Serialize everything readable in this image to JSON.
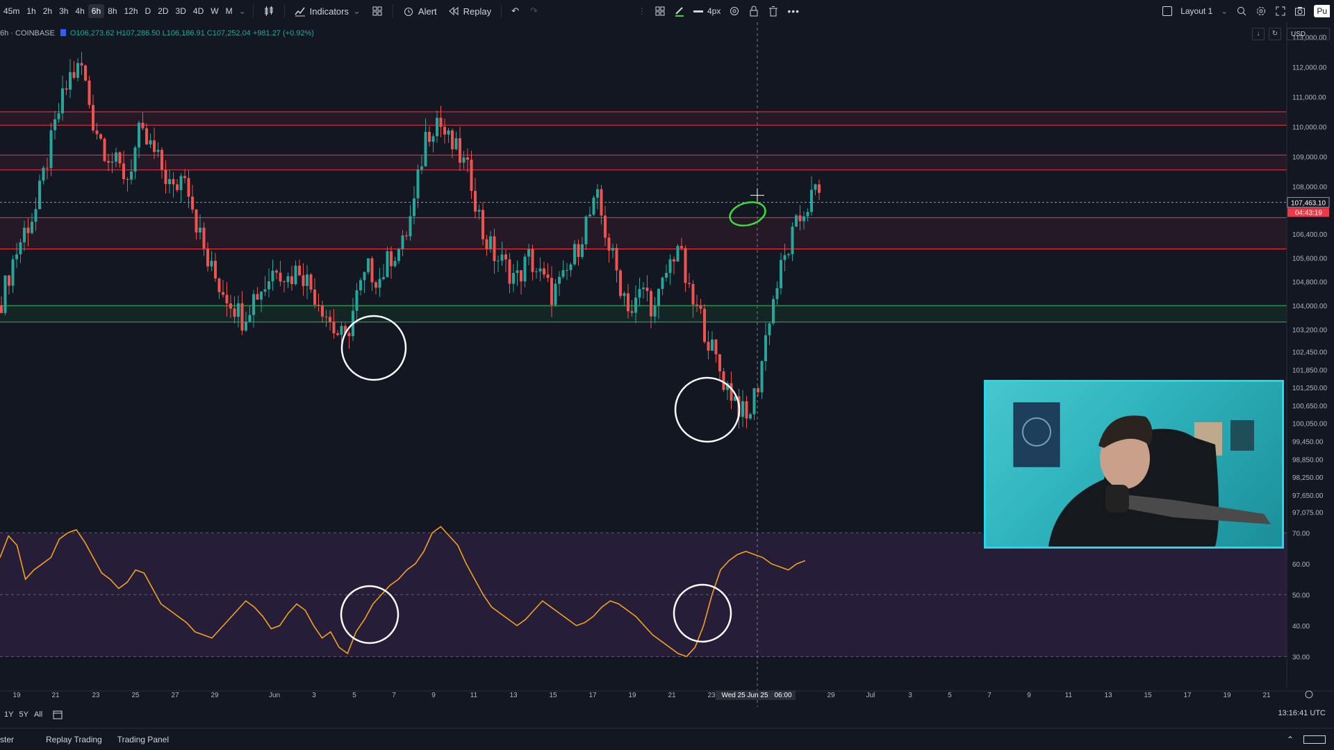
{
  "toolbar": {
    "timeframes": [
      "45m",
      "1h",
      "2h",
      "3h",
      "4h",
      "6h",
      "8h",
      "12h",
      "D",
      "2D",
      "3D",
      "4D",
      "W",
      "M"
    ],
    "active_timeframe": "6h",
    "indicators_label": "Indicators",
    "alert_label": "Alert",
    "replay_label": "Replay",
    "line_width_label": "4px",
    "layout_label": "Layout 1",
    "publish_label": "Pu"
  },
  "legend": {
    "symbol": "6h · COINBASE",
    "ohlc": "O106,273.62 H107,286.50 L106,186.91 C107,252.04 +981.27 (+0.92%)"
  },
  "currency": "USD",
  "chart_data": {
    "type": "candlestick",
    "timeframe": "6h",
    "symbol_exchange": "COINBASE",
    "price_ticks": [
      "113,000.00",
      "112,000.00",
      "111,000.00",
      "110,000.00",
      "109,000.00",
      "108,000.00",
      "107,463.10",
      "106,400.00",
      "105,600.00",
      "104,800.00",
      "104,000.00",
      "103,200.00",
      "102,450.00",
      "101,850.00",
      "101,250.00",
      "100,650.00",
      "100,050.00",
      "99,450.00",
      "98,850.00",
      "98,250.00",
      "97,650.00",
      "97,075.00"
    ],
    "price_ticks_plain": [
      113000,
      112000,
      111000,
      110000,
      109000,
      108000,
      106400,
      105600,
      104800,
      104000,
      103200,
      102450,
      101850,
      101250,
      100650,
      100050,
      99450,
      98850,
      98250,
      97650,
      97075
    ],
    "current_price_label": "107,463.10",
    "countdown_label": "04:43:19",
    "current_price": 107463.1,
    "ylim": [
      96900,
      113200
    ],
    "date_labels": [
      "19",
      "21",
      "23",
      "25",
      "27",
      "29",
      "Jun",
      "3",
      "5",
      "7",
      "9",
      "11",
      "13",
      "15",
      "17",
      "19",
      "21",
      "23",
      "Wed 25 Jun 25",
      "06:00",
      "29",
      "Jul",
      "3",
      "5",
      "7",
      "9",
      "11",
      "13",
      "15",
      "17",
      "19",
      "21"
    ],
    "crosshair_date": "Wed 25 Jun 25",
    "crosshair_time": "06:00",
    "resistance_zones": [
      [
        110050,
        110500
      ],
      [
        108550,
        109050
      ],
      [
        105900,
        106950
      ]
    ],
    "support_zone": [
      103450,
      104000
    ],
    "close_path": [
      104200,
      105500,
      106500,
      107200,
      108900,
      110500,
      111700,
      112000,
      110200,
      109300,
      108700,
      108300,
      109700,
      109300,
      108600,
      107800,
      108600,
      106800,
      105400,
      104700,
      104200,
      103600,
      104300,
      104700,
      105400,
      104900,
      105300,
      104600,
      104000,
      103200,
      102800,
      104300,
      105200,
      104900,
      105700,
      106000,
      107400,
      109700,
      110300,
      109500,
      109000,
      108200,
      106400,
      105700,
      105300,
      104900,
      105600,
      105000,
      104400,
      104800,
      105700,
      106800,
      107500,
      106000,
      104700,
      103800,
      104600,
      103800,
      105100,
      106100,
      104300,
      103600,
      102500,
      101500,
      100900,
      100100,
      101400,
      103700,
      105200,
      106300,
      107200,
      107800,
      107500,
      107300,
      107200,
      107450,
      107463
    ],
    "rsi": {
      "ylim": [
        20,
        75
      ],
      "ticks": [
        70,
        60,
        50,
        40,
        30
      ],
      "tick_labels": [
        "70.00",
        "60.00",
        "50.00",
        "40.00",
        "30.00"
      ],
      "overbought": 70,
      "oversold": 30,
      "color": "#f7a21b",
      "values": [
        62,
        69,
        66,
        55,
        58,
        60,
        62,
        68,
        70,
        71,
        67,
        62,
        57,
        55,
        52,
        54,
        58,
        57,
        52,
        47,
        45,
        43,
        41,
        38,
        37,
        36,
        39,
        42,
        45,
        48,
        46,
        43,
        39,
        40,
        44,
        47,
        45,
        40,
        36,
        38,
        33,
        31,
        38,
        42,
        47,
        50,
        53,
        55,
        58,
        60,
        64,
        70,
        72,
        69,
        66,
        60,
        55,
        50,
        46,
        44,
        42,
        40,
        42,
        45,
        48,
        46,
        44,
        42,
        40,
        41,
        43,
        46,
        48,
        47,
        45,
        43,
        40,
        37,
        35,
        33,
        31,
        30,
        33,
        40,
        50,
        58,
        61,
        63,
        64,
        63,
        62,
        60,
        59,
        58,
        60,
        61
      ]
    },
    "annotations": {
      "circle_color": "#ffffff",
      "highlight_color": "#3ae03a",
      "resistance_color": "#f23645",
      "support_color": "#22ab4a"
    }
  },
  "bottom": {
    "ranges": [
      "1Y",
      "5Y",
      "All"
    ],
    "clock": "13:16:41 UTC",
    "tabs": [
      "ster",
      "Replay Trading",
      "Trading Panel"
    ]
  }
}
